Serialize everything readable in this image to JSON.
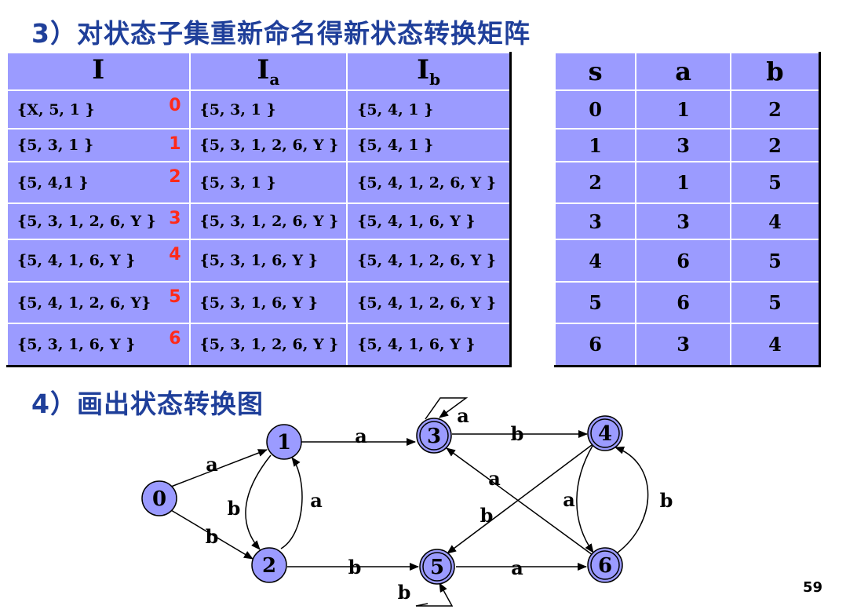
{
  "section3_title": "3）对状态子集重新命名得新状态转换矩阵",
  "section4_title": "4）画出状态转换图",
  "page_number": "59",
  "subset_table": {
    "headers": [
      "I",
      "I",
      "I"
    ],
    "header_subscripts": [
      "",
      "a",
      "b"
    ],
    "rows": [
      {
        "I": "{X, 5, 1 }",
        "id": "0",
        "Ia": "{5, 3, 1 }",
        "Ib": "{5, 4, 1 }"
      },
      {
        "I": "{5, 3, 1 }",
        "id": "1",
        "Ia": "{5, 3, 1, 2, 6, Y }",
        "Ib": "{5, 4, 1 }"
      },
      {
        "I": "{5, 4,1 }",
        "id": "2",
        "Ia": "{5, 3, 1 }",
        "Ib": "{5, 4, 1, 2, 6, Y }"
      },
      {
        "I": "{5, 3, 1, 2, 6, Y }",
        "id": "3",
        "Ia": "{5, 3, 1, 2, 6, Y }",
        "Ib": "{5, 4, 1, 6, Y }"
      },
      {
        "I": "{5, 4, 1, 6, Y }",
        "id": "4",
        "Ia": "{5, 3, 1, 6, Y }",
        "Ib": "{5, 4, 1, 2, 6, Y }"
      },
      {
        "I": "{5, 4, 1, 2, 6, Y}",
        "id": "5",
        "Ia": "{5, 3, 1, 6, Y }",
        "Ib": "{5, 4, 1, 2, 6, Y }"
      },
      {
        "I": "{5, 3, 1, 6, Y }",
        "id": "6",
        "Ia": "{5, 3, 1, 2, 6, Y }",
        "Ib": "{5, 4, 1, 6, Y }"
      }
    ]
  },
  "state_table": {
    "headers": [
      "s",
      "a",
      "b"
    ],
    "rows": [
      [
        "0",
        "1",
        "2"
      ],
      [
        "1",
        "3",
        "2"
      ],
      [
        "2",
        "1",
        "5"
      ],
      [
        "3",
        "3",
        "4"
      ],
      [
        "4",
        "6",
        "5"
      ],
      [
        "5",
        "6",
        "5"
      ],
      [
        "6",
        "3",
        "4"
      ]
    ]
  },
  "diagram": {
    "node_fill": "#9b9bff",
    "states": [
      {
        "label": "0",
        "final": false
      },
      {
        "label": "1",
        "final": false
      },
      {
        "label": "2",
        "final": false
      },
      {
        "label": "3",
        "final": true
      },
      {
        "label": "4",
        "final": true
      },
      {
        "label": "5",
        "final": true
      },
      {
        "label": "6",
        "final": true
      }
    ],
    "edge_labels": {
      "e01": "a",
      "e02": "b",
      "e12": "b",
      "e21": "a",
      "e13": "a",
      "e25": "b",
      "e33": "a",
      "e34": "b",
      "e46": "a",
      "e64": "b",
      "e45": "b",
      "e63": "a",
      "e56": "a",
      "e55": "b"
    }
  },
  "colors": {
    "heading": "#1f3f9a",
    "table_fill": "#9b9bff",
    "state_id": "#ff2a1a"
  }
}
